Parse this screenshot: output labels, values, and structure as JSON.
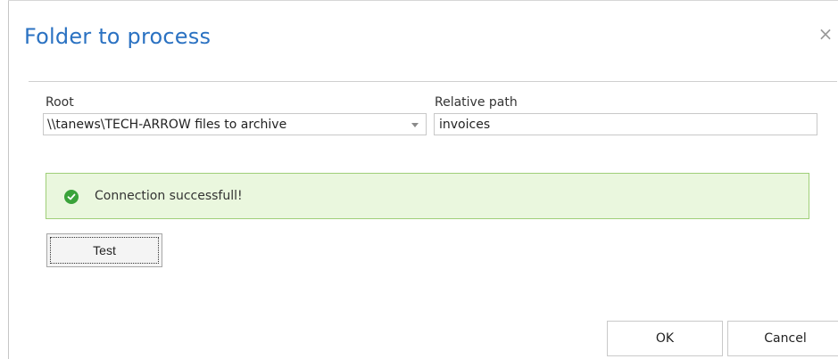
{
  "dialog": {
    "title": "Folder to process",
    "close_symbol": "×"
  },
  "form": {
    "root_label": "Root",
    "root_value": "\\\\tanews\\TECH-ARROW files to archive",
    "relative_path_label": "Relative path",
    "relative_path_value": "invoices"
  },
  "status": {
    "message": "Connection successfull!",
    "icon": "check-circle-icon",
    "color": "#3aa33a",
    "background": "#eaf7de"
  },
  "buttons": {
    "test": "Test",
    "ok": "OK",
    "cancel": "Cancel"
  },
  "colors": {
    "title": "#2b72c2"
  }
}
